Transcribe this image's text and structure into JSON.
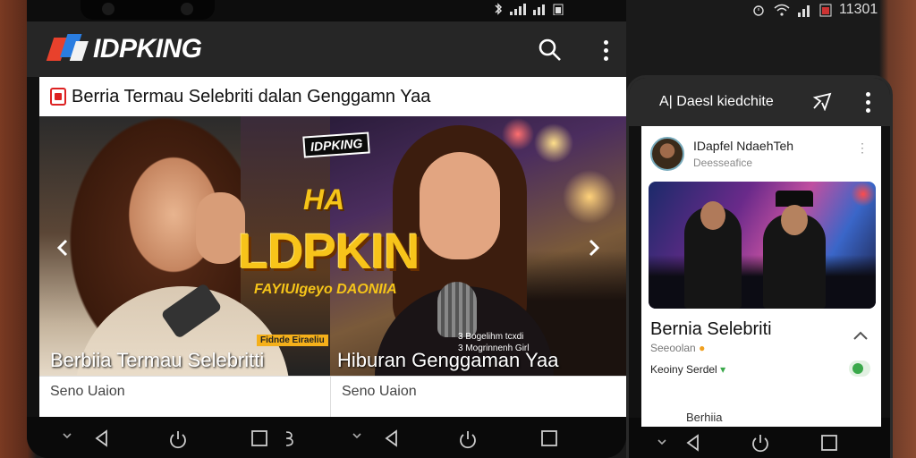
{
  "status_bar": {
    "left_icons_text": "ℬ",
    "right_time": "11301"
  },
  "app_bar": {
    "brand": "IDPKING"
  },
  "page": {
    "title": "Berria Termau Selebriti dalan Genggamn Yaa"
  },
  "carousel": {
    "slides": [
      {
        "caption": "Berbiia Termau Selebritti"
      },
      {
        "caption": "Hiburan Genggaman Yaa"
      }
    ],
    "overlay": {
      "logo": "IDPKING",
      "logo_sub": "",
      "ha": "HA",
      "brand": "LDPKIN",
      "tagline": "FAYIUIgeyo DAONIIA",
      "badge": "Fidnde Eiraeliu",
      "caption": "3 Bogelihm tcxdi\n3 Mogrinnenh Girl"
    },
    "below": [
      "Seno Uaion",
      "Seno Uaion"
    ]
  },
  "right_panel": {
    "header_title": "A| Daesl kiedchite",
    "profile": {
      "name": "IDapfel NdaehTeh",
      "sub": "Deesseafice"
    },
    "post": {
      "title": "Bernia Selebriti",
      "sub1": "Seeoolan",
      "sub2": "Keoiny Serdel",
      "next": "Berhiia"
    }
  },
  "colors": {
    "accent_red": "#e8412c",
    "accent_blue": "#2a7de1",
    "brand_gold": "#f5c419",
    "app_bar": "#262626"
  }
}
